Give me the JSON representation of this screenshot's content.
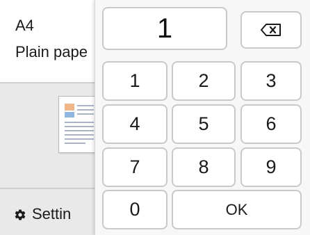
{
  "paper": {
    "size": "A4",
    "type": "Plain pape"
  },
  "settings": {
    "label": "Settin"
  },
  "keypad": {
    "display_value": "1",
    "backspace_icon": "backspace-icon",
    "keys": [
      "1",
      "2",
      "3",
      "4",
      "5",
      "6",
      "7",
      "8",
      "9",
      "0"
    ],
    "ok_label": "OK"
  }
}
